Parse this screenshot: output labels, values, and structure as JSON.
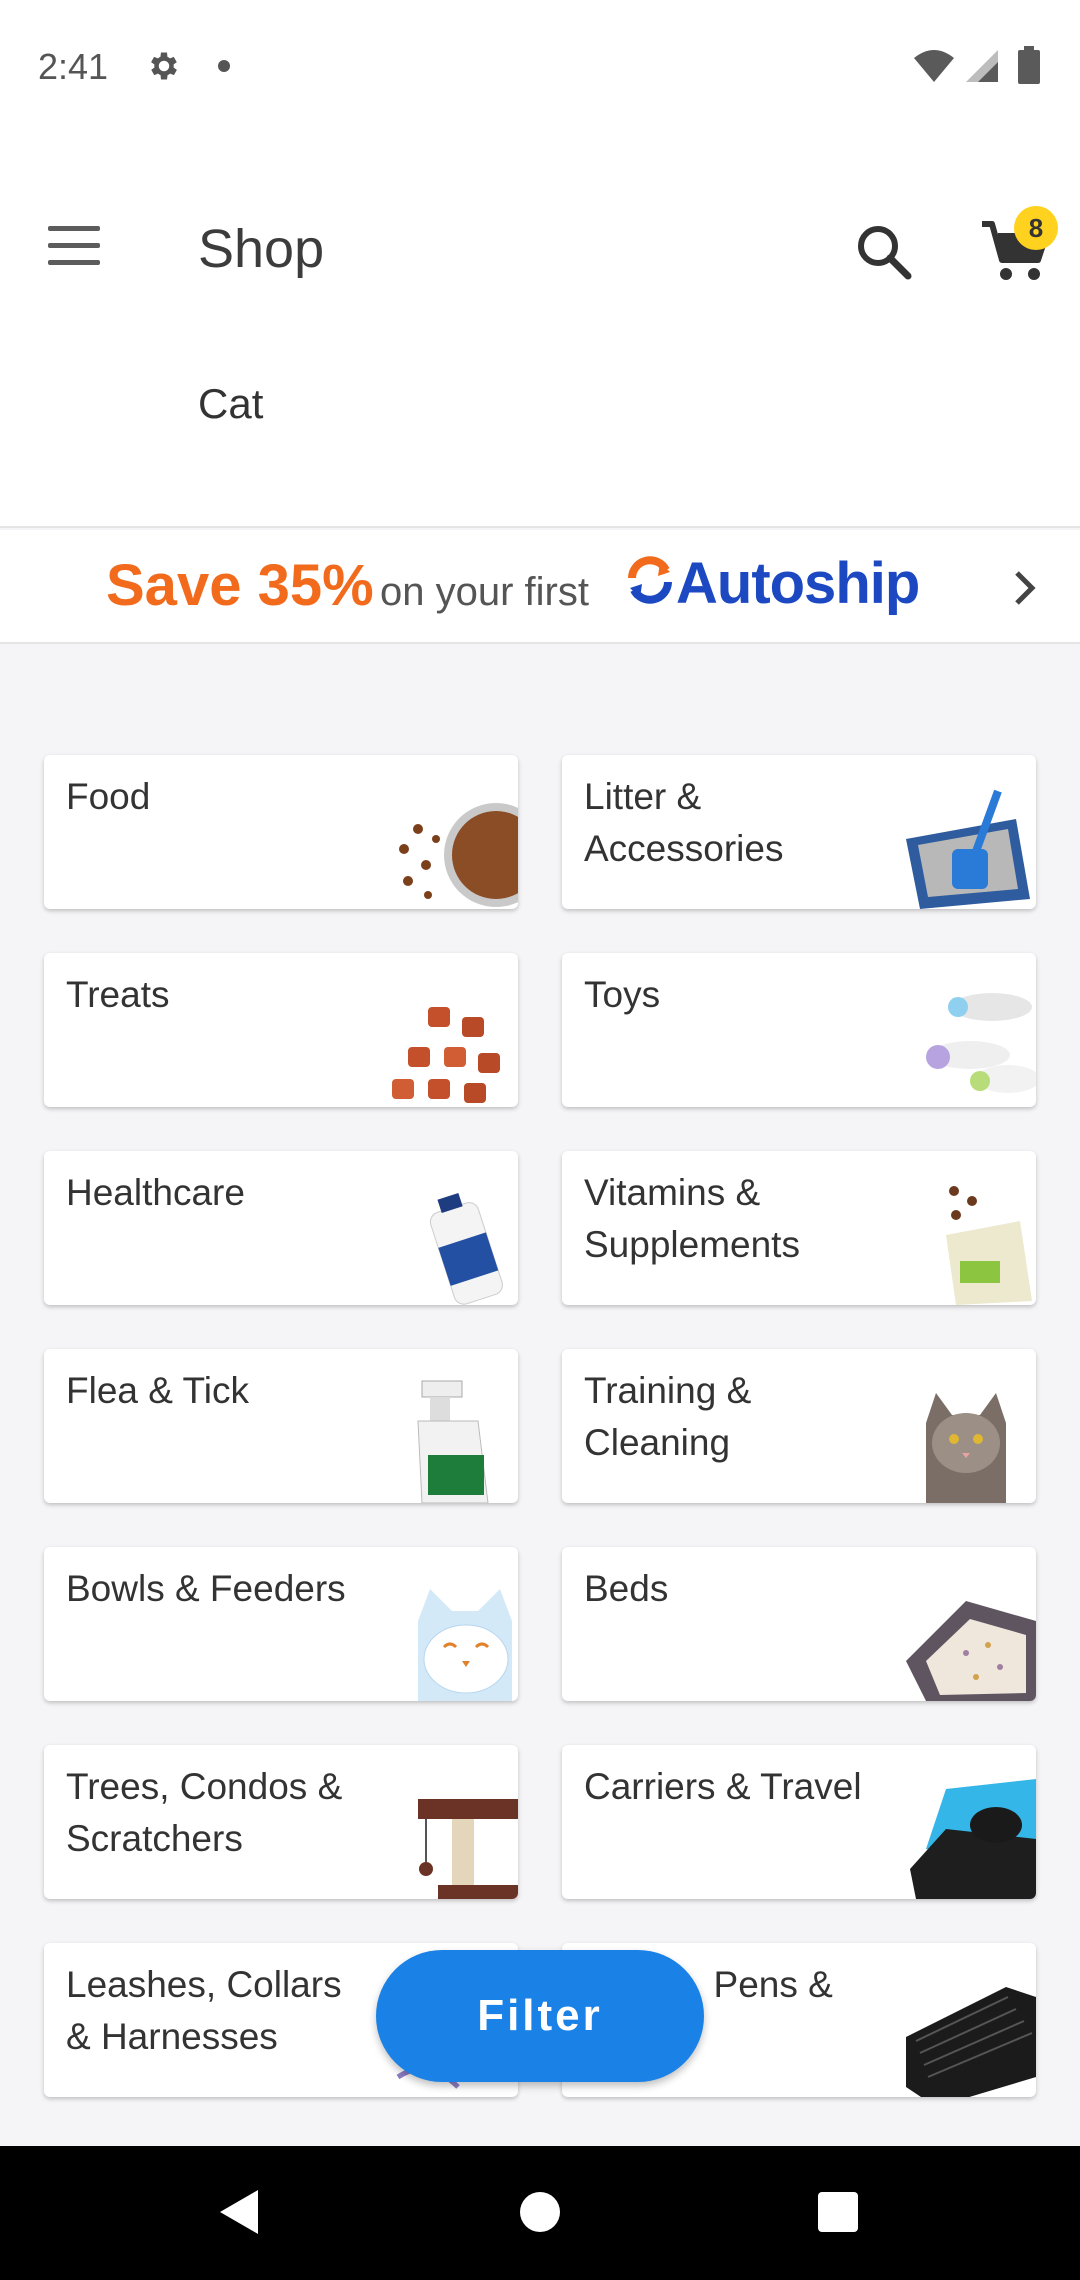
{
  "status_bar": {
    "time": "2:41",
    "icons": [
      "gear-icon",
      "notification-dot-icon",
      "wifi-icon",
      "signal-icon",
      "battery-icon"
    ]
  },
  "app_bar": {
    "title": "Shop",
    "subtitle": "Cat",
    "cart_count": "8",
    "icons": [
      "menu-icon",
      "search-icon",
      "cart-icon"
    ]
  },
  "promo": {
    "save_text": "Save 35%",
    "mid_text": "on your first",
    "brand_text": "Autoship",
    "colors": {
      "save": "#f26b1d",
      "brand": "#1c49c2"
    }
  },
  "categories": [
    {
      "label": "Food",
      "image": "cat-food-bowl"
    },
    {
      "label": "Litter & Accessories",
      "image": "litter-box-scoop"
    },
    {
      "label": "Treats",
      "image": "treat-pieces"
    },
    {
      "label": "Toys",
      "image": "fish-toys"
    },
    {
      "label": "Healthcare",
      "image": "salmon-oil-bottle"
    },
    {
      "label": "Vitamins & Supplements",
      "image": "supplement-bag"
    },
    {
      "label": "Flea & Tick",
      "image": "spray-bottle"
    },
    {
      "label": "Training & Cleaning",
      "image": "cat-photo"
    },
    {
      "label": "Bowls & Feeders",
      "image": "cat-face-bowl"
    },
    {
      "label": "Beds",
      "image": "cat-bed"
    },
    {
      "label": "Trees, Condos & Scratchers",
      "image": "cat-tree"
    },
    {
      "label": "Carriers & Travel",
      "image": "pet-carrier"
    },
    {
      "label": "Leashes, Collars & Harnesses",
      "image": "harness"
    },
    {
      "label": "Crates, Pens &",
      "image": "wire-crate"
    }
  ],
  "filter_button": {
    "label": "Filter",
    "color": "#1a82e6"
  },
  "nav_bar": {
    "icons": [
      "back-icon",
      "home-icon",
      "recents-icon"
    ]
  }
}
